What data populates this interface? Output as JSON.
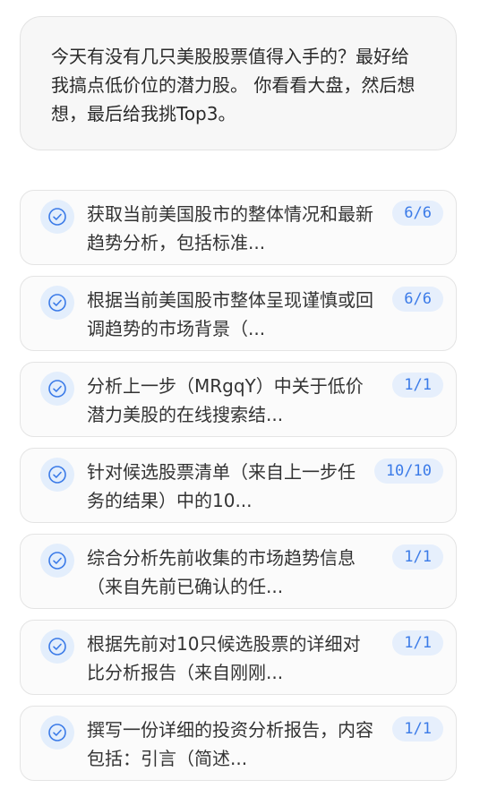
{
  "user_query": {
    "text": "今天有没有几只美股股票值得入手的？最好给我搞点低价位的潜力股。 你看看大盘，然后想想，最后给我挑Top3。"
  },
  "tasks": [
    {
      "text": "获取当前美国股市的整体情况和最新趋势分析，包括标准...",
      "count": "6/6",
      "status_icon": "check-circle-icon"
    },
    {
      "text": "根据当前美国股市整体呈现谨慎或回调趋势的市场背景（...",
      "count": "6/6",
      "status_icon": "check-circle-icon"
    },
    {
      "text": "分析上一步（MRgqY）中关于低价潜力美股的在线搜索结...",
      "count": "1/1",
      "status_icon": "check-circle-icon"
    },
    {
      "text": "针对候选股票清单（来自上一步任务的结果）中的10...",
      "count": "10/10",
      "status_icon": "check-circle-icon"
    },
    {
      "text": "综合分析先前收集的市场趋势信息（来自先前已确认的任...",
      "count": "1/1",
      "status_icon": "check-circle-icon"
    },
    {
      "text": "根据先前对10只候选股票的详细对比分析报告（来自刚刚...",
      "count": "1/1",
      "status_icon": "check-circle-icon"
    },
    {
      "text": "撰写一份详细的投资分析报告，内容包括：引言（简述...",
      "count": "1/1",
      "status_icon": "check-circle-icon"
    }
  ],
  "colors": {
    "accent": "#3b7be8",
    "badge_bg": "#e6effc",
    "icon_bg": "#e3eefc"
  }
}
